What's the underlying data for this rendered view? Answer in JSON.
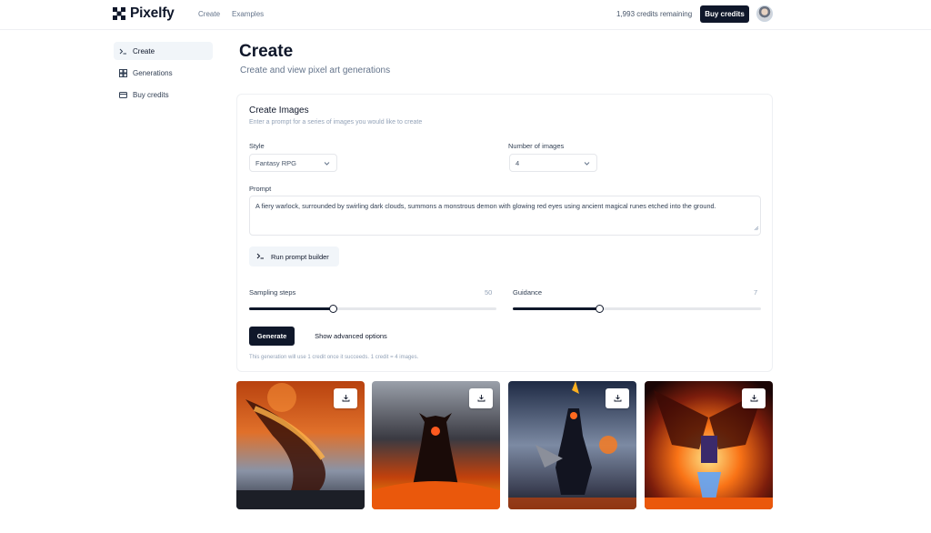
{
  "app": {
    "name": "Pixelfy",
    "nav": [
      "Create",
      "Examples"
    ],
    "credits_remaining": "1,993 credits remaining",
    "buy_credits_label": "Buy credits"
  },
  "sidebar": {
    "items": [
      {
        "label": "Create",
        "icon": "terminal-icon",
        "active": true
      },
      {
        "label": "Generations",
        "icon": "gallery-icon",
        "active": false
      },
      {
        "label": "Buy credits",
        "icon": "credit-card-icon",
        "active": false
      }
    ]
  },
  "page": {
    "title": "Create",
    "subtitle": "Create and view pixel art generations"
  },
  "form": {
    "title": "Create Images",
    "description": "Enter a prompt for a series of images you would like to create",
    "style_label": "Style",
    "style_value": "Fantasy RPG",
    "count_label": "Number of images",
    "count_value": "4",
    "prompt_label": "Prompt",
    "prompt_value": "A fiery warlock, surrounded by swirling dark clouds, summons a monstrous demon with glowing red eyes using ancient magical runes etched into the ground.",
    "prompt_builder_label": "Run prompt builder",
    "sampling_label": "Sampling steps",
    "sampling_value": "50",
    "sampling_fraction": 0.34,
    "guidance_label": "Guidance",
    "guidance_value": "7",
    "guidance_fraction": 0.35,
    "generate_label": "Generate",
    "advanced_label": "Show advanced options",
    "note": "This generation will use 1 credit once it succeeds. 1 credit = 4 images."
  },
  "images": [
    {
      "alt": "fiery demon dragon",
      "download_icon": "download-icon"
    },
    {
      "alt": "horned warlock in flames",
      "download_icon": "download-icon"
    },
    {
      "alt": "warrior with flaming blade",
      "download_icon": "download-icon"
    },
    {
      "alt": "winged fire demon",
      "download_icon": "download-icon"
    }
  ],
  "colors": {
    "primary": "#0f172a",
    "muted": "#64748b",
    "border": "#e5e7eb"
  }
}
